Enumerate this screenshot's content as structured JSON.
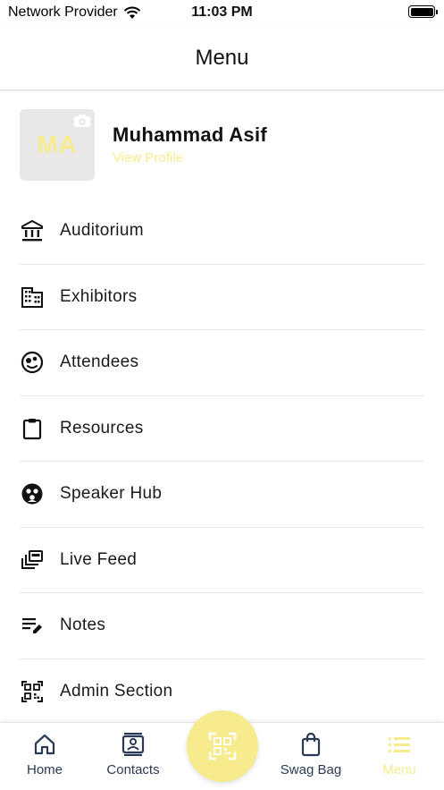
{
  "status_bar": {
    "carrier": "Network Provider",
    "time": "11:03 PM",
    "battery_level": 1.0
  },
  "header": {
    "title": "Menu"
  },
  "profile": {
    "initials": "MA",
    "name": "Muhammad Asif",
    "view_profile": "View Profile"
  },
  "menu": {
    "items": [
      {
        "label": "Auditorium",
        "icon": "bank-icon"
      },
      {
        "label": "Exhibitors",
        "icon": "building-icon"
      },
      {
        "label": "Attendees",
        "icon": "face-icon"
      },
      {
        "label": "Resources",
        "icon": "clipboard-icon"
      },
      {
        "label": "Speaker Hub",
        "icon": "speaker-group-icon"
      },
      {
        "label": "Live Feed",
        "icon": "stacked-cards-icon"
      },
      {
        "label": "Notes",
        "icon": "edit-notes-icon"
      },
      {
        "label": "Admin Section",
        "icon": "qr-code-icon"
      }
    ]
  },
  "tab_bar": {
    "tabs": [
      {
        "label": "Home",
        "icon": "home-icon"
      },
      {
        "label": "Contacts",
        "icon": "contacts-icon"
      },
      {
        "label": "Swag Bag",
        "icon": "bag-icon"
      },
      {
        "label": "Menu",
        "icon": "list-icon"
      }
    ],
    "fab_icon": "qr-scanner-icon",
    "active": "Menu"
  },
  "colors": {
    "accent": "#f6ec8d",
    "tab_text": "#2a3a55",
    "text": "#111111"
  }
}
